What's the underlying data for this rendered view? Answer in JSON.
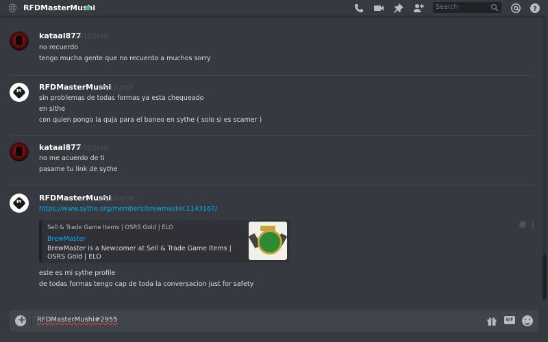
{
  "header": {
    "channel_prefix_icon": "at-icon",
    "username": "RFDMasterMushi",
    "status": "online",
    "search_placeholder": "Search",
    "icons": [
      "call-icon",
      "video-icon",
      "pin-icon",
      "add-friend-icon",
      "search-icon",
      "mention-icon",
      "help-icon"
    ]
  },
  "messages": [
    {
      "author": "kataal877",
      "timestamp": "05/12/2019",
      "lines": [
        "no recuerdo",
        "tengo mucha gente que no recuerdo a muchos sorry"
      ]
    },
    {
      "author": "RFDMasterMushi",
      "timestamp": "05/12/2019",
      "lines": [
        "sin problemas de todas formas ya esta chequeado",
        "en sithe",
        "con quien pongo la quja para el baneo en sythe ( solo si es scamer )"
      ]
    },
    {
      "author": "kataal877",
      "timestamp": "05/12/2019",
      "lines": [
        "no me acuerdo de ti",
        "pasame tu link de sythe"
      ]
    },
    {
      "author": "RFDMasterMushi",
      "timestamp": "05/12/2019",
      "link": "https://www.sythe.org/members/brewmaster.1143167/",
      "embed": {
        "provider": "Sell & Trade Game Items | OSRS Gold | ELO",
        "title": "BrewMaster",
        "description": "BrewMaster is a Newcomer at Sell & Trade Game Items | OSRS Gold | ELO"
      },
      "lines": [
        "este es mi sythe profile",
        "de todas formas tengo cap de toda la conversacion just for safety"
      ]
    }
  ],
  "composer": {
    "value": "RFDMasterMushi#2955",
    "icons": [
      "add-icon",
      "gift-icon",
      "gif-icon",
      "emoji-icon"
    ]
  },
  "colors": {
    "background": "#36393f",
    "link": "#00b0f4",
    "online": "#43b581"
  }
}
